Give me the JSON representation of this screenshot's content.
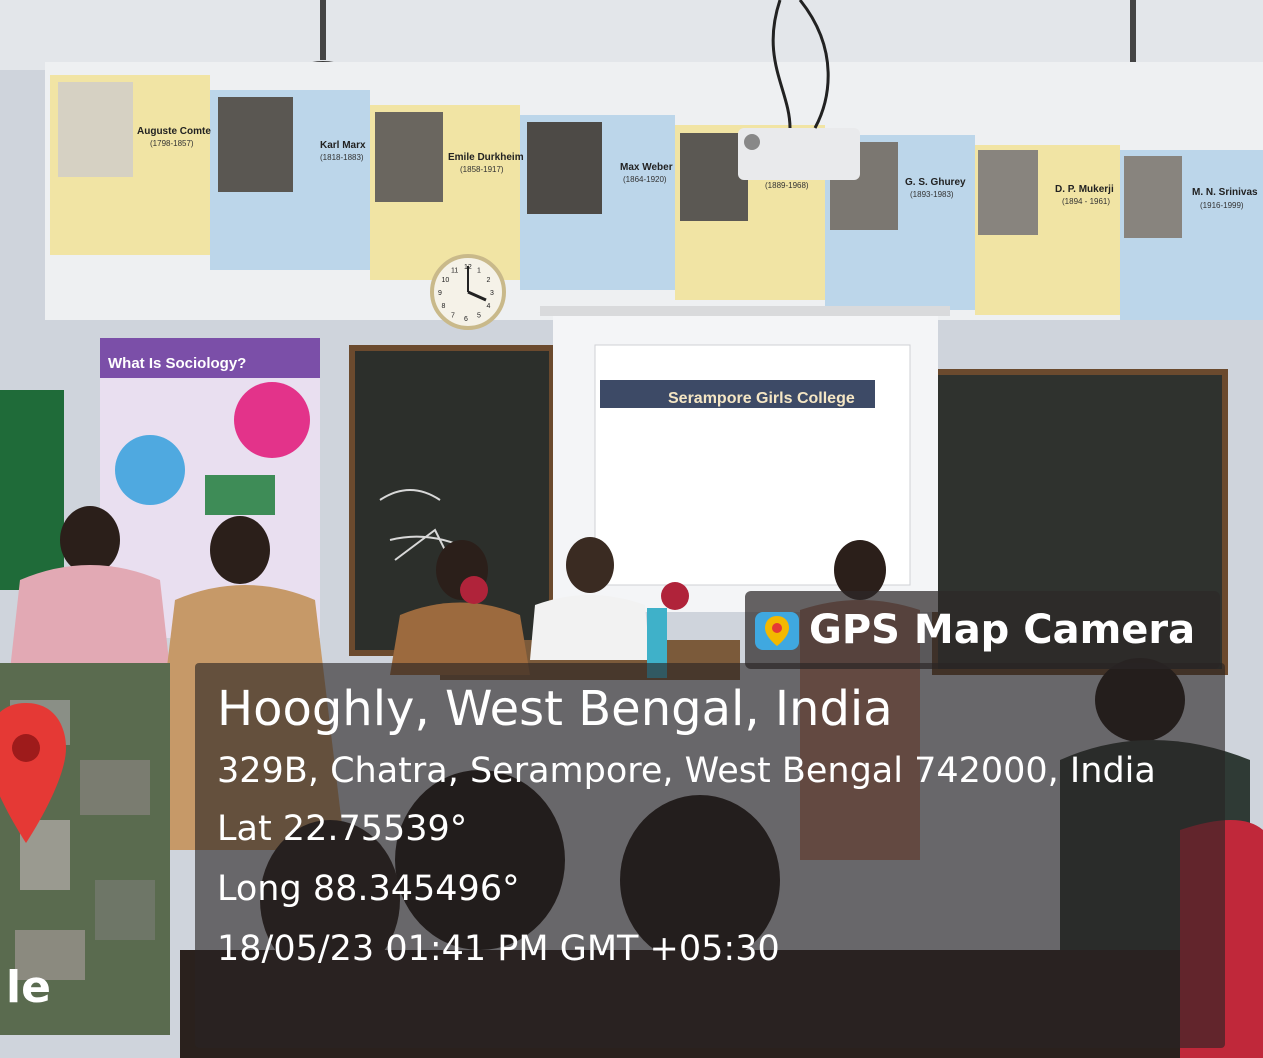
{
  "stamp": {
    "brand": "GPS Map Camera",
    "place": "Hooghly, West Bengal, India",
    "address": "329B, Chatra, Serampore, West Bengal 742000, India",
    "latitude": "Lat 22.75539°",
    "longitude": "Long 88.345496°",
    "datetime": "18/05/23 01:41 PM GMT +05:30"
  },
  "map": {
    "visible_label": "le",
    "pin_color": "#e53935"
  },
  "wall_banner": {
    "names": [
      "Auguste Comte",
      "Karl Marx",
      "Emile Durkheim",
      "Max Weber",
      "G. S. Ghurey",
      "D. P. Mukerji",
      "M. N. Srinivas"
    ],
    "years": [
      "(1798-1857)",
      "(1818-1883)",
      "(1858-1917)",
      "(1864-1920)",
      "(1889-1968)",
      "(1893-1983)",
      "(1894 - 1961)",
      "(1916-1999)"
    ]
  },
  "poster": {
    "title": "What Is Sociology?"
  },
  "projector_slide": {
    "title": "Serampore Girls College"
  },
  "clock": {
    "numerals": [
      "12",
      "1",
      "2",
      "3",
      "4",
      "5",
      "6",
      "7",
      "8",
      "9",
      "10",
      "11"
    ]
  },
  "colors": {
    "wall": "#d8dce4",
    "board": "#2c2f2b",
    "screen": "#f4f5f7",
    "banner_yellow": "#f1e4a4",
    "banner_blue": "#bcd6ea",
    "overlay": "rgba(40,35,35,0.62)"
  }
}
